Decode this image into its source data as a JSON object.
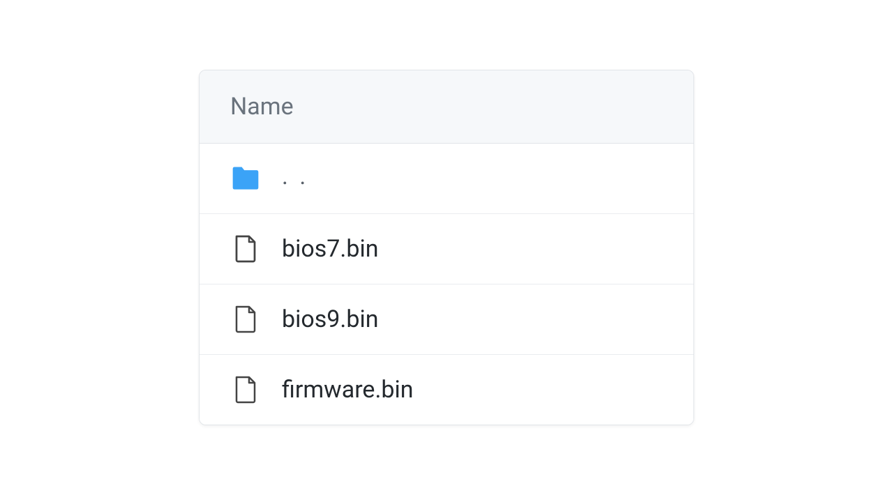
{
  "header": {
    "name_label": "Name"
  },
  "rows": [
    {
      "type": "folder",
      "label": ". ."
    },
    {
      "type": "file",
      "label": "bios7.bin"
    },
    {
      "type": "file",
      "label": "bios9.bin"
    },
    {
      "type": "file",
      "label": "firmware.bin"
    }
  ]
}
